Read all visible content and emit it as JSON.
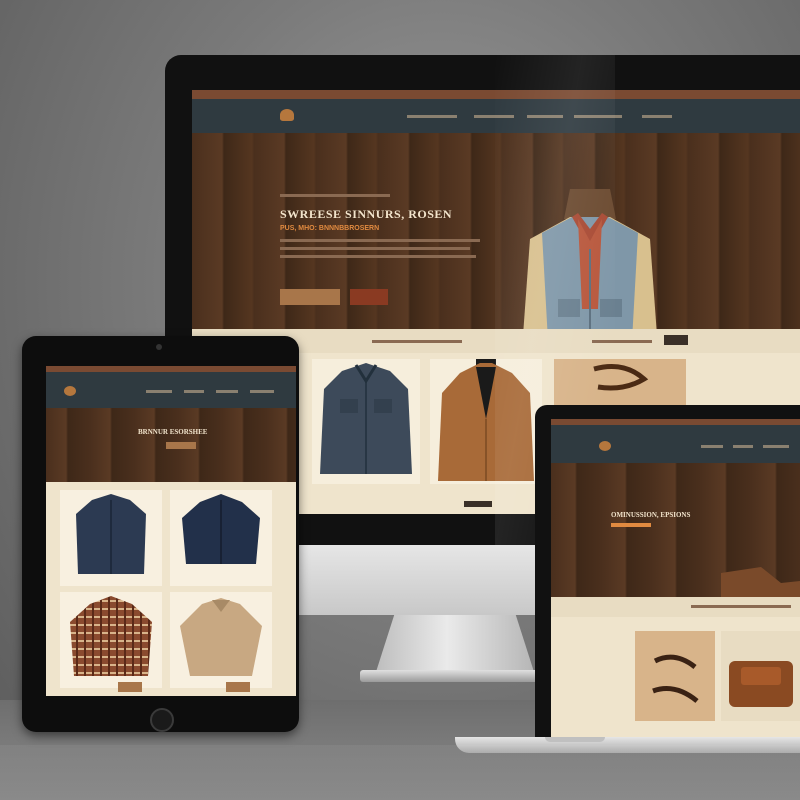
{
  "scene": {
    "description_colors": {
      "wood_dark": "#4a2f1d",
      "nav_slate": "#2f3a40",
      "accent_rust": "#a8764a",
      "cream": "#efe4cc"
    }
  },
  "desktop_site": {
    "hero_title": "SWREESE SINNURS, ROSEN",
    "hero_subtitle": "PUS, MHO: BNNNBBROSERN",
    "icons": {
      "apple": "apple-logo-icon"
    }
  },
  "tablet_site": {
    "hero_title": "BRNNUR ESORSHEE"
  },
  "laptop_site": {
    "hero_title": "OMINUSSION, EPSIONS"
  }
}
